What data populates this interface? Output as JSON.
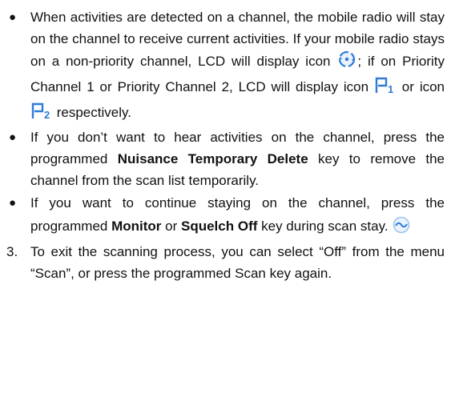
{
  "items": {
    "item1": {
      "bullet": "●",
      "part1": "When activities are detected on a channel, the mobile radio will stay on the channel to receive current activities. If your mobile radio stays on a non-priority channel, LCD will display icon ",
      "part2": "; if on Priority Channel 1 or Priority Channel 2, LCD will display icon ",
      "part3": " or icon ",
      "part4": " respectively."
    },
    "item2": {
      "bullet": "●",
      "part1": "If you don’t want to hear activities on the channel, press the programmed ",
      "key": "Nuisance Temporary Delete",
      "part2": " key to remove the channel from the scan list temporarily."
    },
    "item3": {
      "bullet": "●",
      "part1": "If you want to continue staying on the channel, press the programmed ",
      "key1": "Monitor",
      "part2": " or ",
      "key2": "Squelch Off",
      "part3": " key during scan stay. "
    },
    "item4": {
      "number": "3.",
      "text": "To exit the scanning process, you can select “Off” from the menu “Scan”, or press the programmed Scan key again."
    }
  },
  "icons": {
    "scan_icon": "scan-stay-icon",
    "p1_icon": "priority-1-icon",
    "p2_icon": "priority-2-icon",
    "monitor_icon": "monitor-wave-icon",
    "icon_color": "#2f7bd6",
    "icon_fill_light": "#cfe2f9"
  }
}
